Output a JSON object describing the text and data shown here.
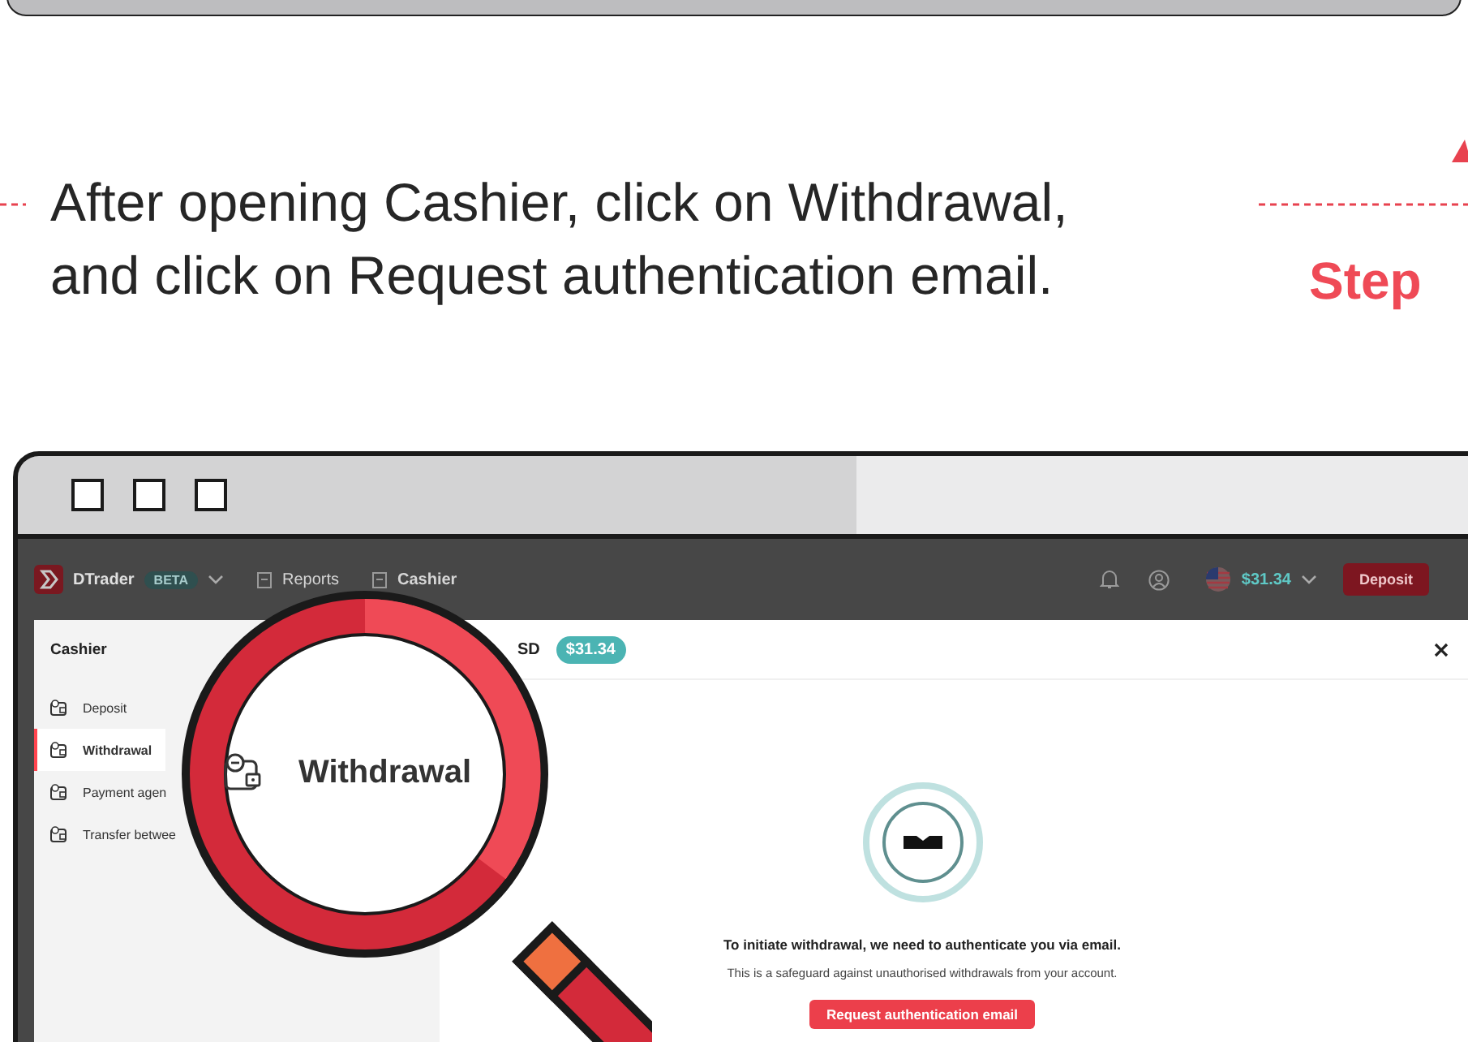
{
  "instruction": {
    "text": "After opening Cashier, click on Withdrawal,\nand click on Request authentication email.",
    "step_label": "Step"
  },
  "app": {
    "brand": "DTrader",
    "badge": "BETA",
    "links": [
      {
        "label": "Reports",
        "selected": false
      },
      {
        "label": "Cashier",
        "selected": true
      }
    ],
    "balance": "$31.34",
    "deposit": "Deposit"
  },
  "modal": {
    "title": "Cashier",
    "currency": "SD",
    "balance": "$31.34",
    "menu": [
      {
        "label": "Deposit",
        "selected": false
      },
      {
        "label": "Withdrawal",
        "selected": true
      },
      {
        "label": "Payment agen",
        "selected": false
      },
      {
        "label": "Transfer betwee",
        "selected": false
      }
    ],
    "heading": "To initiate withdrawal, we need to authenticate you via email.",
    "note": "This is a safeguard against unauthorised withdrawals from your account.",
    "button": "Request authentication email"
  },
  "magnifier": {
    "label": "Withdrawal"
  }
}
